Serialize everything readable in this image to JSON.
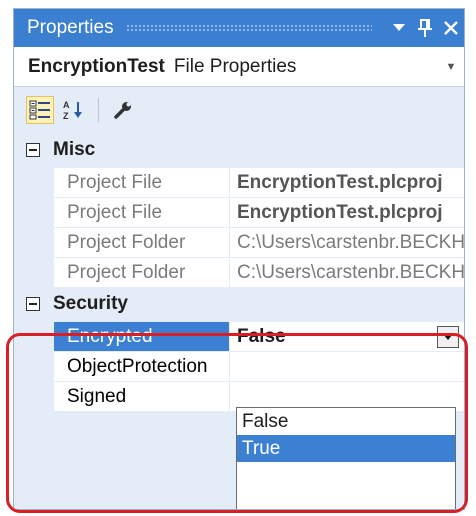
{
  "window": {
    "title": "Properties"
  },
  "selector": {
    "object_name": "EncryptionTest",
    "object_type": "File Properties"
  },
  "toolbar": {
    "categorized_icon": "categorized-icon",
    "alphabetical_icon": "alphabetical-sort-icon",
    "property_pages_icon": "wrench-icon"
  },
  "categories": {
    "misc": {
      "label": "Misc",
      "rows": [
        {
          "name": "Project File",
          "value": "EncryptionTest.plcproj"
        },
        {
          "name": "Project File",
          "value": "EncryptionTest.plcproj"
        },
        {
          "name": "Project Folder",
          "value": "C:\\Users\\carstenbr.BECKHOFF"
        },
        {
          "name": "Project Folder",
          "value": "C:\\Users\\carstenbr.BECKHOFF"
        }
      ]
    },
    "security": {
      "label": "Security",
      "rows": [
        {
          "name": "Encrypted",
          "value": "False"
        },
        {
          "name": "ObjectProtection",
          "value": ""
        },
        {
          "name": "Signed",
          "value": ""
        }
      ]
    }
  },
  "dropdown": {
    "options": [
      "False",
      "True"
    ],
    "selected": "True"
  },
  "colors": {
    "title_bar": "#3b7fd1",
    "selection": "#3c80d3",
    "highlight": "#d81f26"
  }
}
